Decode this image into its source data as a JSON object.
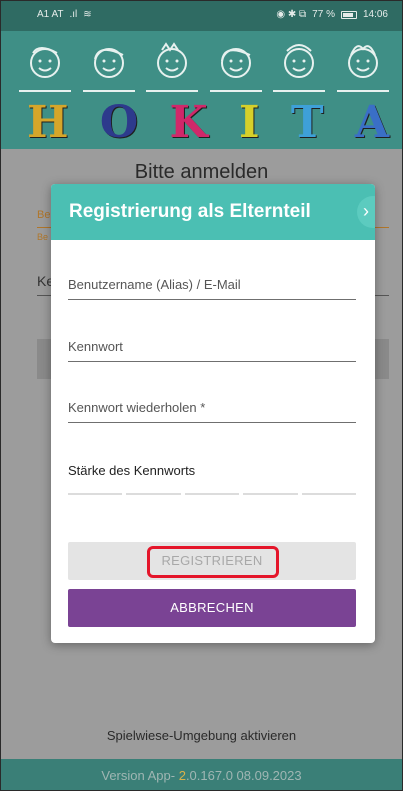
{
  "status_bar": {
    "carrier": "A1 AT",
    "signal": ".ıl",
    "wifi": "≋",
    "indicators": "◉ ✱ ⧉",
    "battery_percent": "77 %",
    "time": "14:06"
  },
  "header": {
    "logo_letters": [
      "H",
      "O",
      "K",
      "I",
      "T",
      "A"
    ],
    "letter_colors": [
      "#d6a62a",
      "#2d3a8c",
      "#d0286a",
      "#d6d02a",
      "#3ea0d8",
      "#3a6fc6"
    ]
  },
  "background_page": {
    "title": "Bitte anmelden",
    "field_label_1": "Be",
    "field_hint_1": "Be",
    "field_label_2": "Ke",
    "sandbox_link": "Spielwiese-Umgebung aktivieren"
  },
  "footer": {
    "version_prefix": "Version App- ",
    "version_highlight": "2",
    "version_rest": ".0.167.0 08.09.2023"
  },
  "dialog": {
    "title": "Registrierung als Elternteil",
    "close_glyph": "›",
    "username_placeholder": "Benutzername (Alias) / E-Mail",
    "password_placeholder": "Kennwort",
    "password_repeat_placeholder": "Kennwort wiederholen *",
    "strength_label": "Stärke des Kennworts",
    "strength_segments": 5,
    "register_button": "REGISTRIEREN",
    "cancel_button": "ABBRECHEN"
  },
  "colors": {
    "teal_header": "#4bbfb3",
    "purple_button": "#7a4394",
    "highlight": "#e4152a"
  }
}
